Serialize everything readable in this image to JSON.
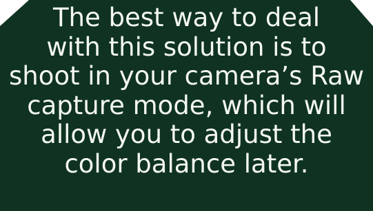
{
  "pullquote": {
    "lines": [
      "The best way to deal",
      "with this solution is to",
      "shoot in your camera’s Raw",
      "capture mode, which will",
      "allow you to adjust the",
      "color balance later."
    ],
    "background_color": "#0f3320",
    "text_color": "#f4f7f2"
  }
}
